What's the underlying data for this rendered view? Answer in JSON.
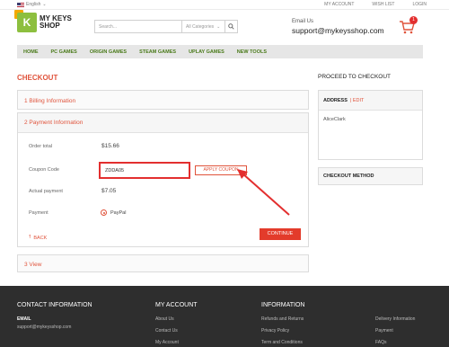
{
  "topbar": {
    "language": "English",
    "links": [
      "MY ACCOUNT",
      "WISH LIST",
      "LOGIN"
    ]
  },
  "header": {
    "logo_line1": "MY KEYS",
    "logo_line2": "SHOP",
    "logo_letter": "K",
    "search_placeholder": "Search...",
    "category_select": "All Categories",
    "email_label": "Email Us",
    "email_value": "support@mykeysshop.com",
    "cart_count": "1"
  },
  "nav": {
    "items": [
      "HOME",
      "PC GAMES",
      "ORIGIN GAMES",
      "STEAM GAMES",
      "UPLAY GAMES",
      "NEW TOOLS"
    ]
  },
  "checkout": {
    "title": "CHECKOUT",
    "step1": "1 Billing Information",
    "step2": "2 Payment Information",
    "step3": "3 View",
    "order_total_label": "Order total",
    "order_total_value": "$15.66",
    "coupon_label": "Coupon Code",
    "coupon_value": "ZDDA05",
    "apply_coupon": "APPLY COUPON",
    "actual_payment_label": "Actual payment",
    "actual_payment_value": "$7.05",
    "payment_label": "Payment",
    "payment_method": "PayPal",
    "back": "BACK",
    "continue": "CONTINUE"
  },
  "sidebar": {
    "title": "PROCEED TO CHECKOUT",
    "address_label": "ADDRESS",
    "edit_label": "EDIT",
    "address_name": "AliceClark",
    "checkout_method": "CHECKOUT METHOD"
  },
  "footer": {
    "contact_title": "CONTACT INFORMATION",
    "email_label": "EMAIL",
    "email_value": "support@mykeysshop.com",
    "account_title": "MY ACCOUNT",
    "account_links": [
      "About Us",
      "Contact Us",
      "My Account"
    ],
    "info_title": "INFORMATION",
    "info_links": [
      "Refunds and Returns",
      "Privacy Policy",
      "Term and Conditions"
    ],
    "extra_links": [
      "Delivery Information",
      "Payment",
      "FAQs"
    ]
  },
  "colors": {
    "accent": "#e0533b",
    "nav_text": "#4a7a1a",
    "footer_bg": "#2e2e2e"
  }
}
